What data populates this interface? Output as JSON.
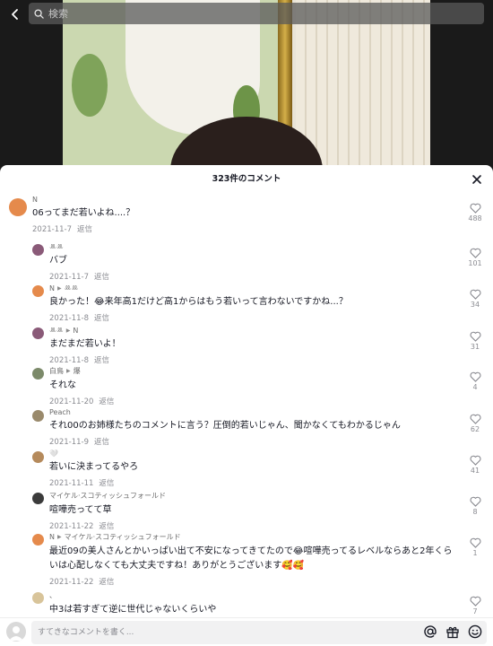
{
  "search": {
    "placeholder": "検索"
  },
  "comments_header": {
    "title": "323件のコメント"
  },
  "reply_label": "返信",
  "comments": [
    {
      "user": "N",
      "user_to": "",
      "text": "06ってまだ若いよね....？",
      "date": "2021-11-7",
      "likes": "488",
      "avatar_color": "#e58a4c"
    },
    {
      "user": "ꔛꔛ",
      "user_to": "",
      "text": "バブ",
      "date": "2021-11-7",
      "likes": "101",
      "avatar_color": "#8a5a78"
    },
    {
      "user": "N",
      "user_to": "ꔛꔛ",
      "text": "良かった！😂来年高1だけど高1からはもう若いって言わないですかね...？",
      "date": "2021-11-8",
      "likes": "34",
      "avatar_color": "#e58a4c"
    },
    {
      "user": "ꔛꔛ",
      "user_to": "N",
      "text": "まだまだ若いよ！",
      "date": "2021-11-8",
      "likes": "31",
      "avatar_color": "#8a5a78"
    },
    {
      "user": "白鳥",
      "user_to": "爆",
      "text": "それな",
      "date": "2021-11-20",
      "likes": "4",
      "avatar_color": "#7c8a6a"
    },
    {
      "user": "Peach",
      "user_to": "",
      "text": "それ00のお姉様たちのコメントに言う？圧倒的若いじゃん、聞かなくてもわかるじゃん",
      "date": "2021-11-9",
      "likes": "62",
      "avatar_color": "#9a8a6c"
    },
    {
      "user": "🤍",
      "user_to": "",
      "text": "若いに決まってるやろ",
      "date": "2021-11-11",
      "likes": "41",
      "avatar_color": "#b58a5c"
    },
    {
      "user": "マイケル·スコティッシュフォールド",
      "user_to": "",
      "text": "喧嘩売ってて草",
      "date": "2021-11-22",
      "likes": "8",
      "avatar_color": "#3b3b3b"
    },
    {
      "user": "N",
      "user_to": "マイケル·スコティッシュフォールド",
      "text": "最近09の美人さんとかいっぱい出て不安になってきてたので😂喧嘩売ってるレベルならあと2年くらいは心配しなくても大丈夫ですね！ありがとうございます🥰🥰",
      "date": "2021-11-22",
      "likes": "1",
      "avatar_color": "#e58a4c"
    },
    {
      "user": "、",
      "user_to": "",
      "text": "中3は若すぎて逆に世代じゃないくらいや",
      "date": "",
      "likes": "7",
      "avatar_color": "#d8c49a"
    }
  ],
  "composer": {
    "placeholder": "すてきなコメントを書く..."
  },
  "icons": {
    "back": "back-arrow-icon",
    "search": "search-icon",
    "close": "close-icon",
    "heart": "heart-icon",
    "mention": "at-icon",
    "gift": "gift-icon",
    "emoji": "emoji-icon"
  }
}
